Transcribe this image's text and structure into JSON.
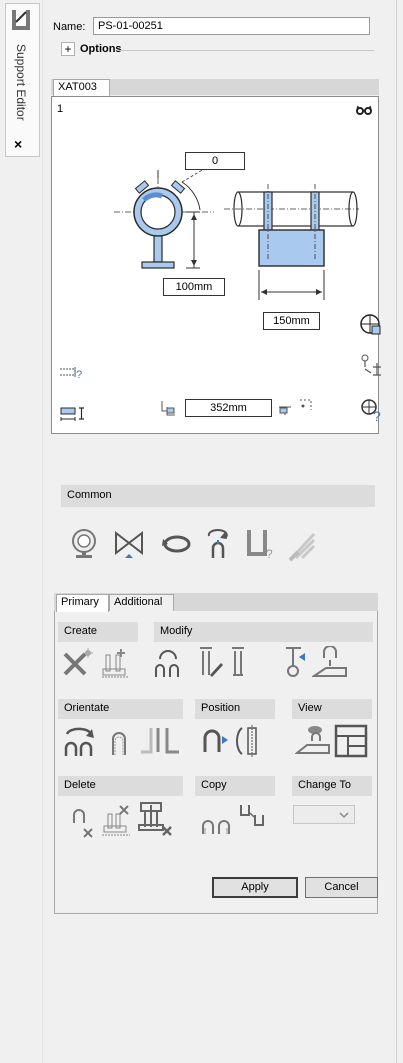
{
  "sidebar": {
    "title": "Support Editor",
    "close": "×"
  },
  "name_field": {
    "label": "Name:",
    "value": "PS-01-00251"
  },
  "options": {
    "label": "Options",
    "toggle": "+"
  },
  "view_tab": {
    "label": "XAT003"
  },
  "preview": {
    "index": "1",
    "angle_value": "0",
    "height_value": "100mm",
    "width_value": "150mm",
    "length_value": "352mm"
  },
  "common": {
    "header": "Common"
  },
  "tabs": {
    "primary": "Primary",
    "additional": "Additional"
  },
  "groups": {
    "create": "Create",
    "modify": "Modify",
    "orientate": "Orientate",
    "position": "Position",
    "view": "View",
    "delete": "Delete",
    "copy": "Copy",
    "change_to": "Change To"
  },
  "buttons": {
    "apply": "Apply",
    "cancel": "Cancel"
  },
  "colors": {
    "steel_fill": "#a9c9ee",
    "steel_stroke": "#2b2b2b",
    "icon_gray": "#8a8a8a",
    "icon_blue": "#3a78c2"
  }
}
